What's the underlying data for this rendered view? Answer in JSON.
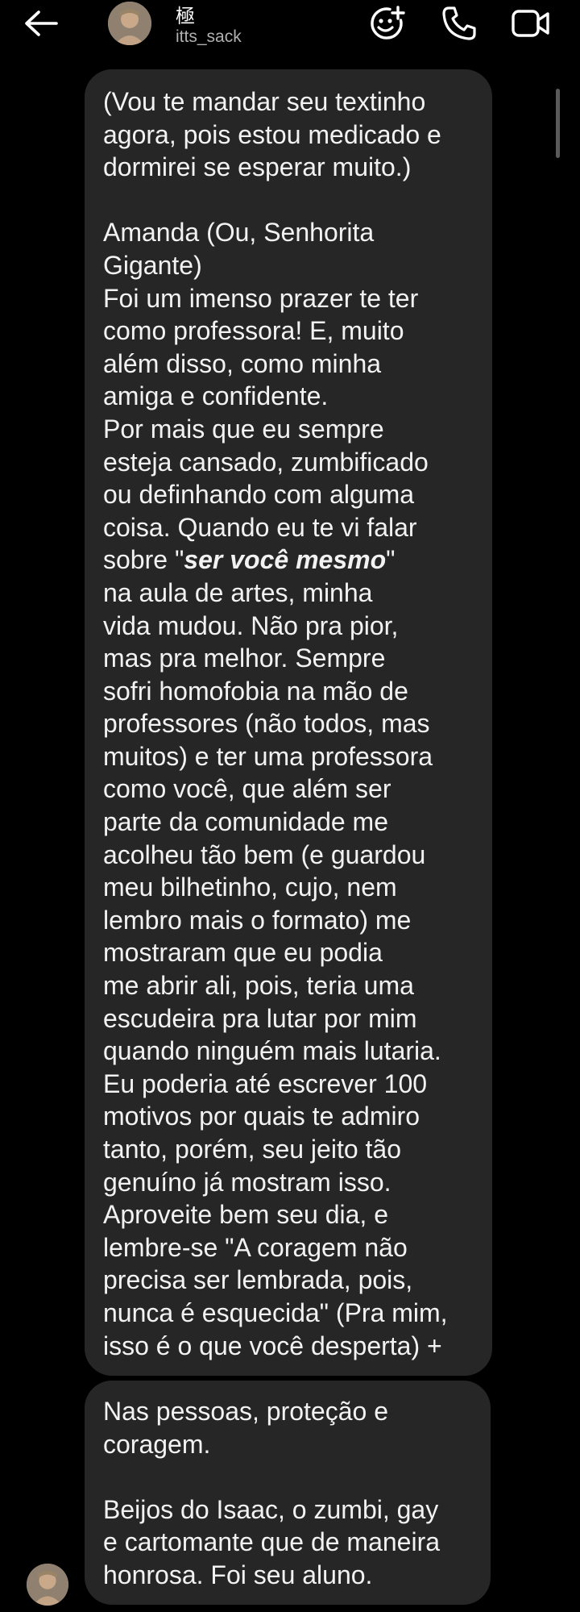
{
  "header": {
    "back_icon": "arrow-left-icon",
    "display_name": "極",
    "username": "itts_sack",
    "effects_icon": "sticker-plus-icon",
    "call_icon": "phone-icon",
    "video_icon": "video-camera-icon"
  },
  "messages": [
    {
      "sender": "me",
      "part1": "(Vou te mandar seu textinho\nagora, pois estou medicado e\ndormirei se esperar muito.)\n\nAmanda (Ou, Senhorita\nGigante)\nFoi um imenso prazer te ter\ncomo professora! E, muito\nalém disso, como minha\namiga e confidente.\nPor mais que eu sempre\nesteja cansado, zumbificado\nou definhando com alguma\ncoisa. Quando eu te vi falar\nsobre \"",
      "emphasis": "ser você mesmo",
      "part2": "\"\nna aula de artes, minha\nvida mudou. Não pra pior,\nmas pra melhor. Sempre\nsofri homofobia na mão de\nprofessores (não todos, mas\nmuitos) e ter uma professora\ncomo você, que além ser\nparte da comunidade me\nacolheu tão bem (e guardou\nmeu bilhetinho, cujo, nem\nlembro mais o formato) me\nmostraram que eu podia\nme abrir ali, pois, teria uma\nescudeira pra lutar por mim\nquando ninguém mais lutaria.\nEu poderia até escrever 100\nmotivos por quais te admiro\ntanto, porém, seu jeito tão\ngenuíno já mostram isso.\nAproveite bem seu dia, e\nlembre-se \"A coragem não\nprecisa ser lembrada, pois,\nnunca é esquecida\" (Pra mim,\nisso é o que você desperta) +"
    },
    {
      "sender": "me",
      "text": "Nas pessoas, proteção e\ncoragem.\n\nBeijos do Isaac, o zumbi, gay\ne cartomante que de maneira\nhonrosa. Foi seu aluno."
    }
  ],
  "colors": {
    "background": "#000000",
    "bubble": "#262626",
    "text": "#f2f2f2",
    "subtext": "#b0b0b0"
  }
}
